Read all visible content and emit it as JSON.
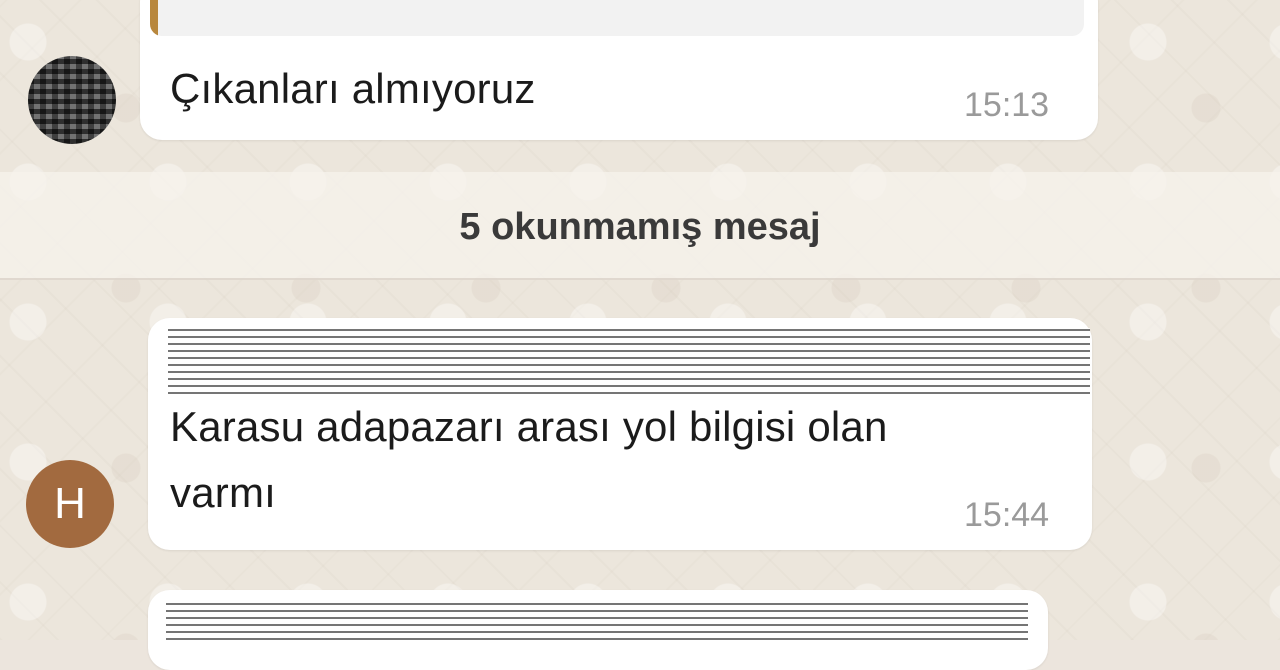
{
  "chat": {
    "messages": [
      {
        "text": "Çıkanları almıyoruz",
        "time": "15:13",
        "avatar": "blurred-profile-photo"
      },
      {
        "text_line1": "Karasu adapazarı arası yol bilgisi olan",
        "text_line2": "varmı",
        "time": "15:44",
        "avatar_initial": "H"
      }
    ],
    "unread_banner": "5 okunmamış mesaj"
  },
  "colors": {
    "background": "#ece6dc",
    "bubble": "#ffffff",
    "avatar_h": "#a26a3f",
    "reply_accent": "#b8873d",
    "time_text": "#9a9a9a"
  }
}
